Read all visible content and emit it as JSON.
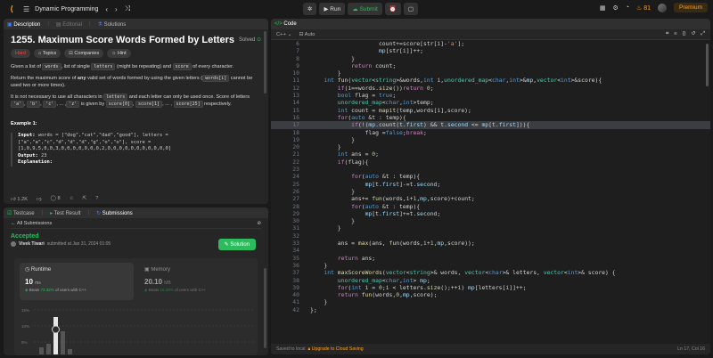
{
  "topbar": {
    "title": "Dynamic Programming",
    "run_label": "Run",
    "submit_label": "Submit",
    "streak": "81",
    "premium_label": "Premium"
  },
  "description_panel": {
    "tabs": [
      "Description",
      "Editorial",
      "Solutions"
    ],
    "title": "1255. Maximum Score Words Formed by Letters",
    "solved_label": "Solved",
    "tags": [
      "Hard",
      "Topics",
      "Companies",
      "Hint"
    ],
    "p1_a": "Given a list of ",
    "p1_code1": "words",
    "p1_b": ", list of  single ",
    "p1_code2": "letters",
    "p1_c": " (might be repeating) and ",
    "p1_code3": "score",
    "p1_d": " of every character.",
    "p2_a": "Return the maximum score of ",
    "p2_bold": "any",
    "p2_b": " valid set of words formed by using the given letters (",
    "p2_code": "words[i]",
    "p2_c": " cannot be used two or more times).",
    "p3_a": "It is not necessary to use all characters in ",
    "p3_code1": "letters",
    "p3_b": " and each letter can only be used once. Score of letters ",
    "p3_code2": "'a'",
    "p3_code3": "'b'",
    "p3_code4": "'c'",
    "p3_dots": ", ... ,",
    "p3_code5": "'z'",
    "p3_c": " is given by ",
    "p3_code6": "score[0]",
    "p3_code7": "score[1]",
    "p3_code8": "score[25]",
    "p3_d": " respectively.",
    "example_title": "Example 1:",
    "example_input_label": "Input:",
    "example_input": " words = [\"dog\",\"cat\",\"dad\",\"good\"], letters = [\"a\",\"a\",\"c\",\"d\",\"d\",\"d\",\"g\",\"o\",\"o\"], score = [1,0,9,5,0,0,3,0,0,0,0,0,0,0,2,0,0,0,0,0,0,0,0,0,0,0]",
    "example_output_label": "Output:",
    "example_output": " 23",
    "example_expl_label": "Explanation:",
    "likes": "1.2K",
    "comments": "8"
  },
  "submissions_panel": {
    "tabs": [
      "Testcase",
      "Test Result",
      "Submissions"
    ],
    "back_label": "All Submissions",
    "status": "Accepted",
    "submitter": "Vivek Tiwari",
    "submitted_at": "submitted at Jan 31, 2024 01:05",
    "solution_label": "Solution",
    "runtime_label": "Runtime",
    "runtime_value": "10",
    "runtime_unit": "ms",
    "runtime_beats_label": "Beats",
    "runtime_beats": "73.32%",
    "runtime_beats_suffix": "of users with C++",
    "memory_label": "Memory",
    "memory_value": "20.10",
    "memory_unit": "MB",
    "memory_beats_label": "Beats",
    "memory_beats": "15.39%",
    "memory_beats_suffix": "of users with C++",
    "hist_ticks": [
      "15%",
      "10%",
      "5%"
    ]
  },
  "code_panel": {
    "tab_label": "Code",
    "language": "C++",
    "auto_label": "Auto",
    "status_left": "Saved to local",
    "upgrade_label": "Upgrade to Cloud Saving",
    "cursor": "Ln 17, Col 16"
  }
}
